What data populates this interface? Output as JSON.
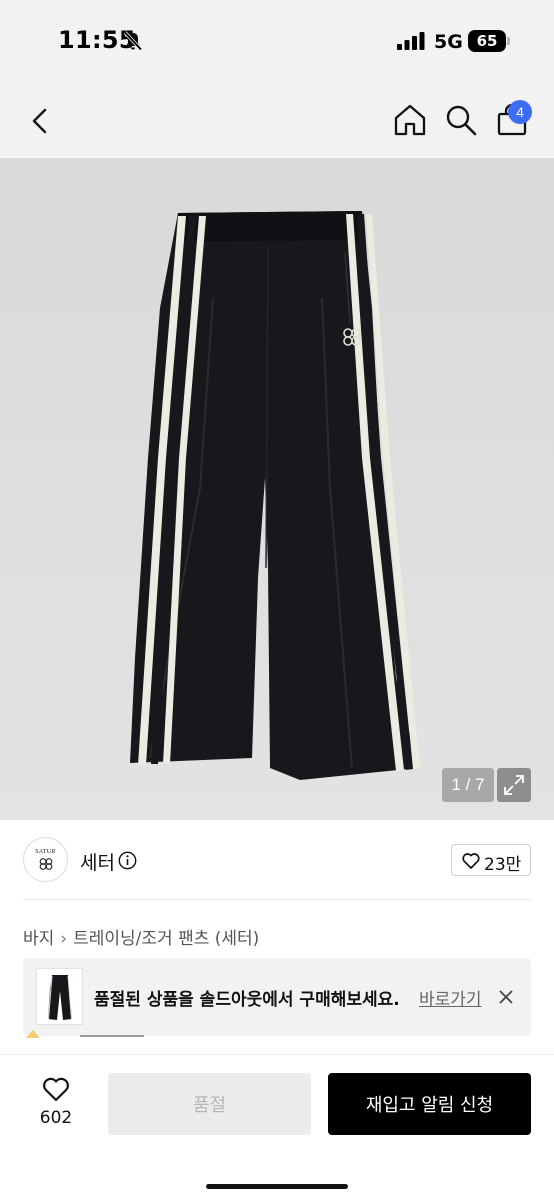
{
  "status_bar": {
    "time": "11:55",
    "network": "5G",
    "battery": "65"
  },
  "nav": {
    "cart_count": "4"
  },
  "gallery": {
    "counter": "1 / 7"
  },
  "brand": {
    "name": "세터",
    "logo_text": "SATUR",
    "like_count": "23만"
  },
  "breadcrumb": {
    "items": [
      "바지",
      "트레이닝/조거 팬츠 (세터)"
    ]
  },
  "banner": {
    "text": "품절된 상품을 솔드아웃에서 구매해보세요.",
    "link": "바로가기"
  },
  "bottom": {
    "wish_count": "602",
    "soldout_label": "품절",
    "restock_label": "재입고 알림 신청"
  },
  "colors": {
    "accent_badge": "#3a6cf4",
    "primary_button": "#000000",
    "disabled_button": "#ebebeb",
    "background_gray": "#f2f2f2"
  },
  "icons": [
    "bell-slash-icon",
    "signal-icon",
    "back-icon",
    "home-icon",
    "search-icon",
    "bag-icon",
    "expand-icon",
    "info-icon",
    "heart-icon",
    "close-icon"
  ]
}
